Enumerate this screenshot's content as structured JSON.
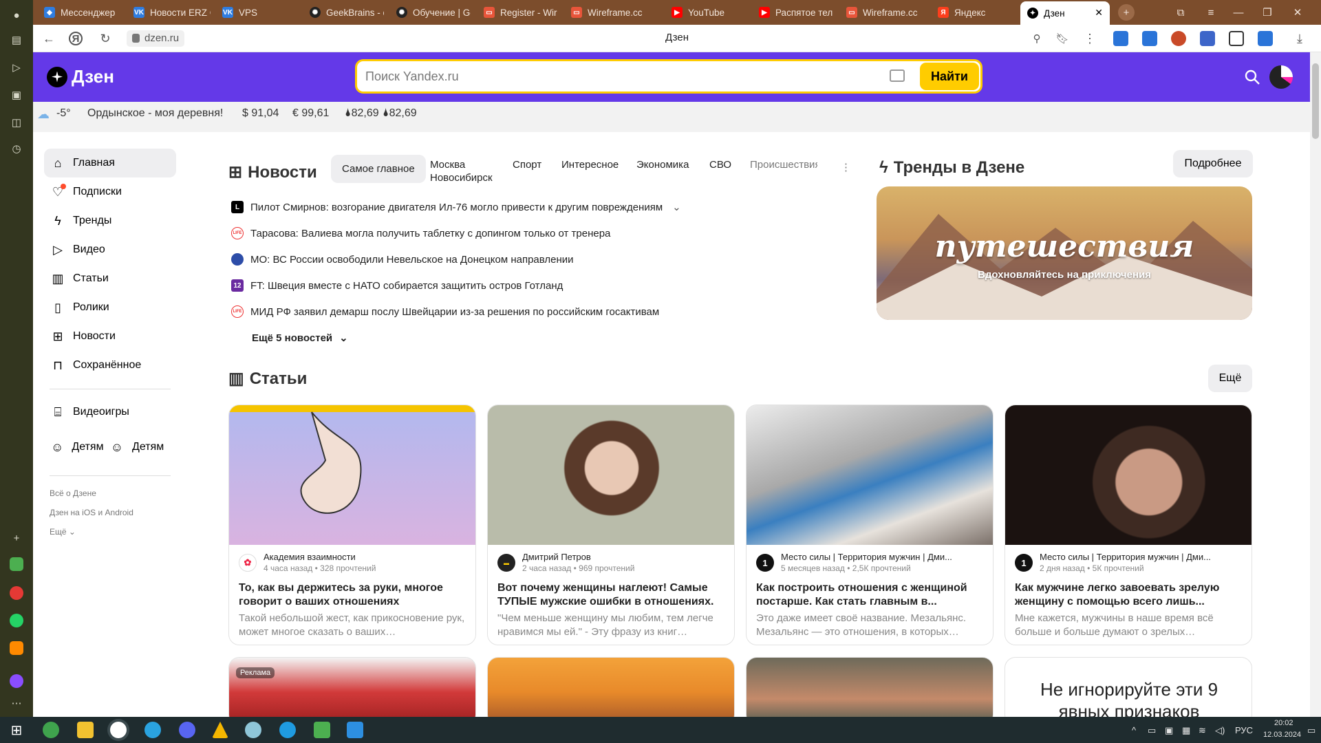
{
  "browser": {
    "tabs": [
      {
        "label": "Мессенджер",
        "icon": "vk-messenger-icon",
        "color": "#2f7de1"
      },
      {
        "label": "Новости ERZ С",
        "icon": "vk-icon",
        "color": "#2f7de1"
      },
      {
        "label": "VPS",
        "icon": "vk-icon",
        "color": "#2f7de1"
      },
      {
        "label": "GeekBrains - о",
        "icon": "openai-icon",
        "color": "#222222"
      },
      {
        "label": "Обучение | Ge",
        "icon": "openai-icon",
        "color": "#222222"
      },
      {
        "label": "Register - Wir",
        "icon": "wireframe-icon",
        "color": "#e8553a"
      },
      {
        "label": "Wireframe.cc",
        "icon": "wireframe-icon",
        "color": "#e8553a"
      },
      {
        "label": "YouTube",
        "icon": "youtube-icon",
        "color": "#ff0000"
      },
      {
        "label": "Распятое тело",
        "icon": "youtube-icon",
        "color": "#ff0000"
      },
      {
        "label": "Wireframe.cc",
        "icon": "wireframe-icon",
        "color": "#e8553a"
      },
      {
        "label": "Яндекс",
        "icon": "yandex-icon",
        "color": "#fc3f1d"
      },
      {
        "label": "Дзен",
        "icon": "dzen-icon",
        "color": "#000000",
        "active": true
      }
    ],
    "url": "dzen.ru",
    "page_title": "Дзен"
  },
  "dzen": {
    "logo_text": "Дзен",
    "search": {
      "placeholder": "Поиск Yandex.ru",
      "value": "",
      "button": "Найти"
    },
    "info": {
      "temperature": "-5°",
      "location": "Ордынское - моя деревня!",
      "usd": "$ 91,04",
      "eur": "€ 99,61",
      "oil1": "82,69",
      "oil2": "82,69"
    },
    "sidebar": {
      "items": [
        "Главная",
        "Подписки",
        "Тренды",
        "Видео",
        "Статьи",
        "Ролики",
        "Новости",
        "Сохранённое"
      ],
      "games": "Видеоигры",
      "kids1": "Детям",
      "kids2": "Детям",
      "about": "Всё о Дзене",
      "apps": "Дзен на iOS и Android",
      "more": "Ещё"
    },
    "news": {
      "title": "Новости",
      "tabs": [
        "Самое главное",
        "Москва Новосибирск",
        "Спорт",
        "Интересное",
        "Экономика",
        "СВО",
        "Происшествия"
      ],
      "items": [
        {
          "text": "Пилот Смирнов: возгорание двигателя Ил-76 могло привести к другим повреждениям",
          "src": "L"
        },
        {
          "text": "Тарасова: Валиева могла получить таблетку с допингом только от тренера",
          "src": "LIFE"
        },
        {
          "text": "МО: ВС России освободили Невельское на Донецком направлении",
          "src": ""
        },
        {
          "text": "FT: Швеция вместе с НАТО собирается защитить остров Готланд",
          "src": "12"
        },
        {
          "text": "МИД РФ заявил демарш послу Швейцарии из-за решения по российским госактивам",
          "src": "LIFE"
        }
      ],
      "more": "Ещё 5 новостей"
    },
    "trends": {
      "title": "Тренды в Дзене",
      "more_button": "Подробнее",
      "card_title": "путешествия",
      "card_subtitle": "Вдохновляйтесь на приключения"
    },
    "articles": {
      "title": "Статьи",
      "more_button": "Ещё",
      "cards": [
        {
          "author": "Академия взаимности",
          "meta": "4 часа назад • 328 прочтений",
          "title": "То, как вы держитесь за руки, многое говорит о ваших отношениях",
          "excerpt": "Такой небольшой жест, как прикосновение рук, может многое сказать о ваших…",
          "avatar": ""
        },
        {
          "author": "Дмитрий Петров",
          "meta": "2 часа назад • 969 прочтений",
          "title": "Вот почему женщины наглеют! Самые ТУПЫЕ мужские ошибки в отношениях.",
          "excerpt": "\"Чем меньше женщину мы любим, тем легче нравимся мы ей.\" - Эту фразу из книг…",
          "avatar": ""
        },
        {
          "author": "Место силы | Территория мужчин | Дми...",
          "meta": "5 месяцев назад • 2,5К прочтений",
          "title": "Как построить отношения с женщиной постарше. Как стать главным в...",
          "excerpt": "Это даже имеет своё название. Мезальянс. Мезальянс — это отношения, в которых…",
          "avatar": "1"
        },
        {
          "author": "Место силы | Территория мужчин | Дми...",
          "meta": "2 дня назад • 5К прочтений",
          "title": "Как мужчине легко завоевать зрелую женщину с помощью всего лишь...",
          "excerpt": "Мне кажется, мужчины в наше время всё больше и больше думают о зрелых…",
          "avatar": "1"
        }
      ],
      "ad_badge": "Реклама",
      "card4_text": "Не игнорируйте эти 9 явных признаков"
    }
  },
  "taskbar": {
    "lang": "РУС",
    "time": "20:02",
    "date": "12.03.2024"
  }
}
